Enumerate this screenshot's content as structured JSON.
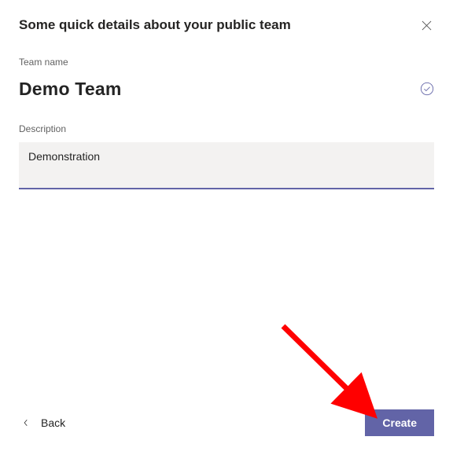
{
  "dialog": {
    "title": "Some quick details about your public team"
  },
  "team_name": {
    "label": "Team name",
    "value": "Demo Team"
  },
  "description": {
    "label": "Description",
    "value": "Demonstration"
  },
  "actions": {
    "back": "Back",
    "create": "Create"
  },
  "colors": {
    "accent": "#6264a7",
    "arrow": "#ff0000"
  }
}
